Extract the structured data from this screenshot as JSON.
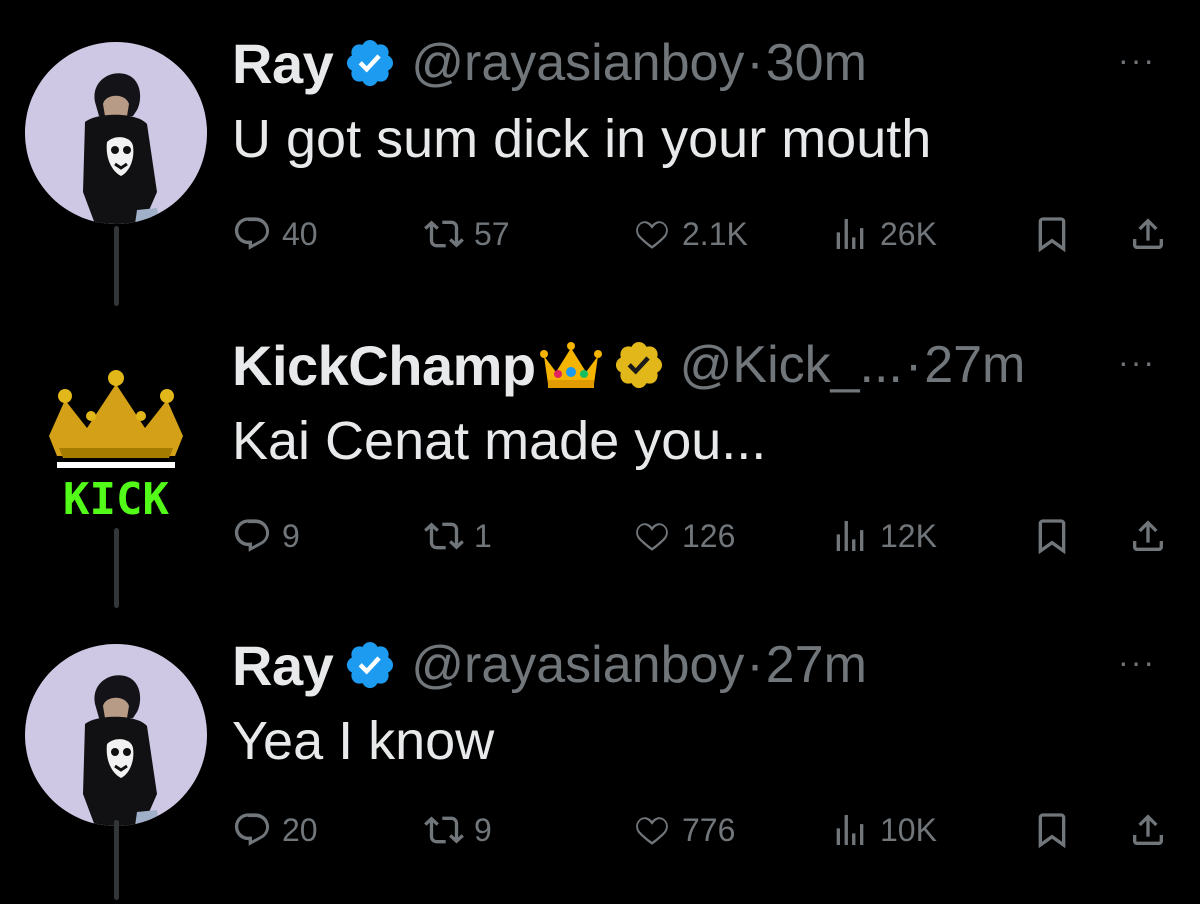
{
  "colors": {
    "background": "#000000",
    "primary_text": "#e7e9ea",
    "secondary_text": "#71767b",
    "verified_blue": "#1d9bf0",
    "verified_gold": "#e2b719",
    "kick_green": "#53fc18"
  },
  "tweets": [
    {
      "name": "Ray",
      "handle": "@rayasianboy",
      "dot": "·",
      "time": "30m",
      "more": "···",
      "text": "U got sum dick in your mouth",
      "verified": "blue-check-icon",
      "replies": "40",
      "retweets": "57",
      "likes": "2.1K",
      "views": "26K"
    },
    {
      "name": "KickChamp",
      "name_emoji": "crown-emoji",
      "handle": "@Kick_...",
      "dot": "·",
      "time": "27m",
      "more": "···",
      "text": "Kai Cenat made you...",
      "verified": "gold-check-icon",
      "avatar_text": "KICK",
      "replies": "9",
      "retweets": "1",
      "likes": "126",
      "views": "12K"
    },
    {
      "name": "Ray",
      "handle": "@rayasianboy",
      "dot": "·",
      "time": "27m",
      "more": "···",
      "text": "Yea I know",
      "verified": "blue-check-icon",
      "replies": "20",
      "retweets": "9",
      "likes": "776",
      "views": "10K"
    }
  ]
}
